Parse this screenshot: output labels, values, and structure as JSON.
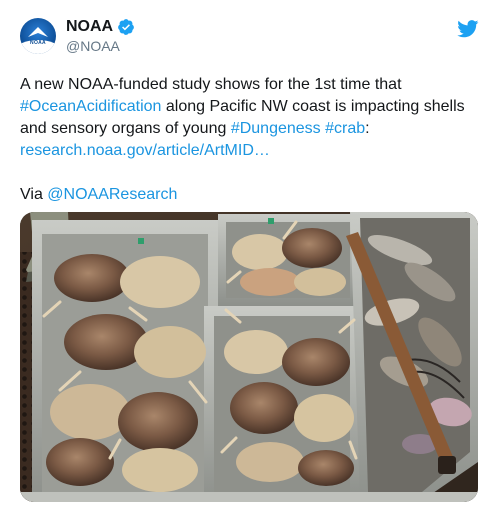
{
  "account": {
    "display_name": "NOAA",
    "handle": "@NOAA",
    "avatar_text": "NOAA"
  },
  "tweet": {
    "line1": "A new NOAA-funded study shows for the 1st time that",
    "hashtag_ocean": "#OceanAcidification",
    "line2_rest": " along Pacific NW coast is impacting shells",
    "line3_start": "and sensory organs of young ",
    "hashtag_dungeness": "#Dungeness",
    "space": " ",
    "hashtag_crab": "#crab",
    "colon": ":",
    "url": "research.noaa.gov/article/ArtMID…",
    "via_label": "Via ",
    "via_mention": "@NOAAResearch"
  },
  "colors": {
    "link": "#1b95e0",
    "verified": "#1da1f2",
    "brand_twitter": "#1da1f2"
  },
  "icons": {
    "verified": "verified-badge-icon",
    "twitter": "twitter-bird-icon"
  }
}
